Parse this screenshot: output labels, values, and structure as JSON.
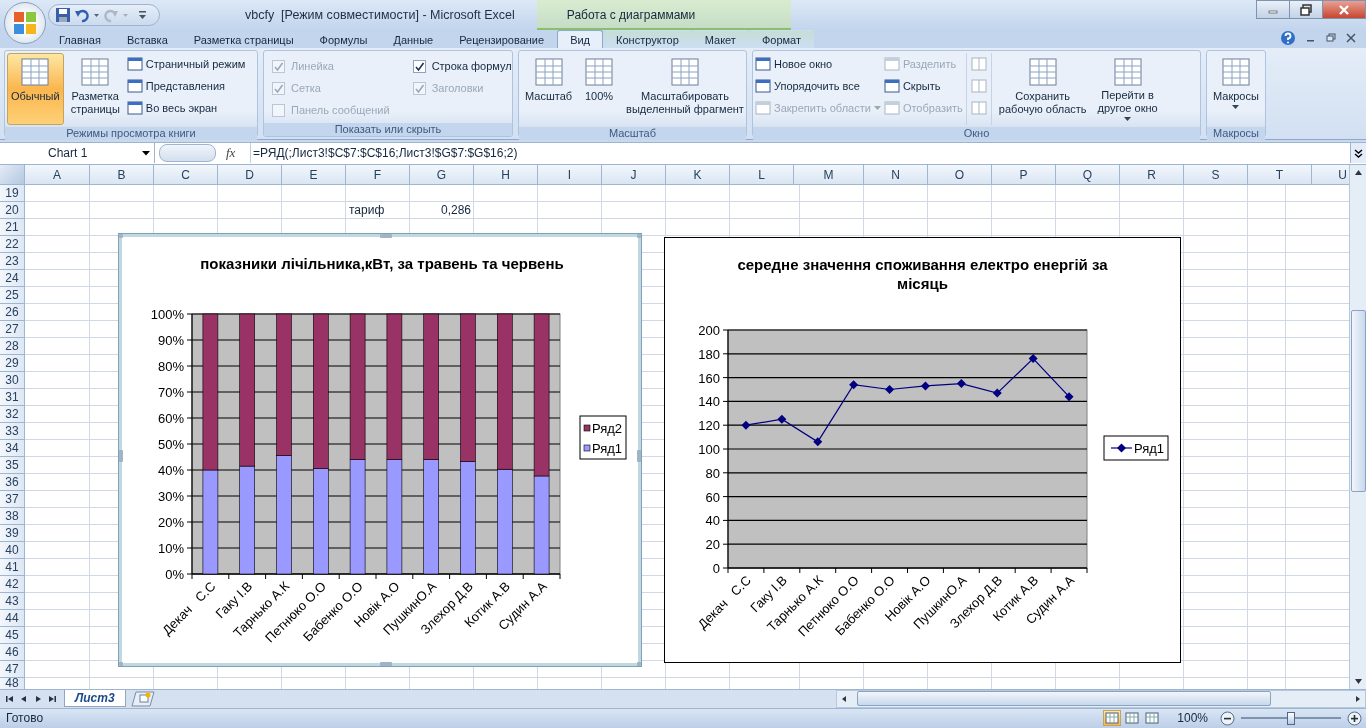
{
  "window": {
    "title": "vbcfy  [Режим совместимости] - Microsoft Excel",
    "context_group": "Работа с диаграммами"
  },
  "tabs": [
    {
      "label": "Главная",
      "selected": false,
      "kind": "main"
    },
    {
      "label": "Вставка",
      "selected": false,
      "kind": "main"
    },
    {
      "label": "Разметка страницы",
      "selected": false,
      "kind": "main"
    },
    {
      "label": "Формулы",
      "selected": false,
      "kind": "main"
    },
    {
      "label": "Данные",
      "selected": false,
      "kind": "main"
    },
    {
      "label": "Рецензирование",
      "selected": false,
      "kind": "main"
    },
    {
      "label": "Вид",
      "selected": true,
      "kind": "main"
    },
    {
      "label": "Конструктор",
      "selected": false,
      "kind": "context"
    },
    {
      "label": "Макет",
      "selected": false,
      "kind": "context"
    },
    {
      "label": "Формат",
      "selected": false,
      "kind": "context"
    }
  ],
  "ribbon_groups": [
    {
      "label": "Режимы просмотра книги",
      "columns": [
        [
          {
            "kind": "large",
            "label": "Обычный",
            "selected": true
          }
        ],
        [
          {
            "kind": "large",
            "label": "Разметка\nстраницы",
            "selected": false
          }
        ],
        [
          {
            "kind": "small",
            "label": "Страничный режим",
            "disabled": false
          },
          {
            "kind": "small",
            "label": "Представления",
            "disabled": false
          },
          {
            "kind": "small",
            "label": "Во весь экран",
            "disabled": false
          }
        ]
      ]
    },
    {
      "label": "Показать или скрыть",
      "columns": [
        [
          {
            "kind": "checkbox",
            "label": "Линейка",
            "checked": true,
            "disabled": true
          },
          {
            "kind": "checkbox",
            "label": "Сетка",
            "checked": true,
            "disabled": true
          },
          {
            "kind": "checkbox",
            "label": "Панель сообщений",
            "checked": false,
            "disabled": true
          }
        ],
        [
          {
            "kind": "checkbox",
            "label": "Строка формул",
            "checked": true,
            "disabled": false
          },
          {
            "kind": "checkbox",
            "label": "Заголовки",
            "checked": true,
            "disabled": true
          }
        ]
      ]
    },
    {
      "label": "Масштаб",
      "columns": [
        [
          {
            "kind": "large",
            "label": "Масштаб"
          }
        ],
        [
          {
            "kind": "large",
            "label": "100%"
          }
        ],
        [
          {
            "kind": "large",
            "label": "Масштабировать\nвыделенный фрагмент"
          }
        ]
      ]
    },
    {
      "label": "Окно",
      "columns": [
        [
          {
            "kind": "small",
            "label": "Новое окно",
            "disabled": false
          },
          {
            "kind": "small",
            "label": "Упорядочить все",
            "disabled": false
          },
          {
            "kind": "small",
            "label": "Закрепить области",
            "disabled": true,
            "dropdown": true
          }
        ],
        [
          {
            "kind": "small",
            "label": "Разделить",
            "disabled": true
          },
          {
            "kind": "small",
            "label": "Скрыть",
            "disabled": false
          },
          {
            "kind": "small",
            "label": "Отобразить",
            "disabled": true
          }
        ],
        [
          {
            "kind": "icon",
            "disabled": true
          },
          {
            "kind": "icon",
            "disabled": true
          },
          {
            "kind": "icon",
            "disabled": true
          }
        ],
        [
          {
            "kind": "large",
            "label": "Сохранить\nрабочую область"
          }
        ],
        [
          {
            "kind": "large",
            "label": "Перейти в\nдругое окно",
            "dropdown": true
          }
        ]
      ]
    },
    {
      "label": "Макросы",
      "columns": [
        [
          {
            "kind": "large",
            "label": "Макросы",
            "dropdown": true
          }
        ]
      ]
    }
  ],
  "formula_bar": {
    "name_box": "Chart 1",
    "fx": "fx",
    "formula": "=РЯД(;Лист3!$C$7:$C$16;Лист3!$G$7:$G$16;2)"
  },
  "sheet": {
    "columns": [
      "A",
      "B",
      "C",
      "D",
      "E",
      "F",
      "G",
      "H",
      "I",
      "J",
      "K",
      "L",
      "M",
      "N",
      "O",
      "P",
      "Q",
      "R",
      "S",
      "T",
      "U"
    ],
    "rows": [
      {
        "number": "19"
      },
      {
        "number": "20",
        "cells": [
          null,
          null,
          null,
          null,
          null,
          {
            "value": "тариф",
            "kind": "text"
          },
          {
            "value": "0,286",
            "kind": "number"
          }
        ]
      },
      {
        "number": "21"
      },
      {
        "number": "22"
      },
      {
        "number": "23"
      },
      {
        "number": "24"
      },
      {
        "number": "25"
      },
      {
        "number": "26"
      },
      {
        "number": "27"
      },
      {
        "number": "28"
      },
      {
        "number": "29"
      },
      {
        "number": "30"
      },
      {
        "number": "31"
      },
      {
        "number": "32"
      },
      {
        "number": "33"
      },
      {
        "number": "34"
      },
      {
        "number": "35"
      },
      {
        "number": "36"
      },
      {
        "number": "37"
      },
      {
        "number": "38"
      },
      {
        "number": "39"
      },
      {
        "number": "40"
      },
      {
        "number": "41"
      },
      {
        "number": "42"
      },
      {
        "number": "43"
      },
      {
        "number": "44"
      },
      {
        "number": "45"
      },
      {
        "number": "46"
      },
      {
        "number": "47"
      },
      {
        "number": "48"
      }
    ]
  },
  "charts": [
    {
      "selected": true,
      "chart_data": {
        "type": "bar",
        "stacked": true,
        "grid": true,
        "legend": true,
        "title": "показники лічільника,кВт, за травень та червень",
        "categories": [
          "Декач   С.С",
          "Гаку І.В",
          "Тарнько А.К",
          "Петнюко О.О",
          "Бабенко О.О",
          "Новік А.О",
          "ПушкинО.А",
          "Злехор Д.В",
          "Котик А.В",
          "Судин А.А"
        ],
        "series": [
          {
            "name": "Ряд1",
            "color": "#9999ff",
            "values": [
              40,
              41.5,
              45.5,
              40.5,
              44,
              44,
              44,
              43.3,
              40.3,
              37.7
            ]
          },
          {
            "name": "Ряд2",
            "color": "#993366",
            "values": [
              60,
              58.5,
              54.5,
              59.5,
              56,
              56,
              56,
              56.7,
              59.7,
              62.3
            ]
          }
        ],
        "ylim": [
          0,
          100
        ],
        "yticks": [
          {
            "value": 0,
            "label": "0%"
          },
          {
            "value": 10,
            "label": "10%"
          },
          {
            "value": 20,
            "label": "20%"
          },
          {
            "value": 30,
            "label": "30%"
          },
          {
            "value": 40,
            "label": "40%"
          },
          {
            "value": 50,
            "label": "50%"
          },
          {
            "value": 60,
            "label": "60%"
          },
          {
            "value": 70,
            "label": "70%"
          },
          {
            "value": 80,
            "label": "80%"
          },
          {
            "value": 90,
            "label": "90%"
          },
          {
            "value": 100,
            "label": "100%"
          }
        ]
      }
    },
    {
      "selected": false,
      "chart_data": {
        "type": "line",
        "grid": true,
        "legend": true,
        "title": "середне значення споживання електро енергій за місяць",
        "categories": [
          "Декач   С.С",
          "Гаку І.В",
          "Тарнько А.К",
          "Петнюко О.О",
          "Бабенко О.О",
          "Новік А.О",
          "ПушкинО.А",
          "Злехор Д.В",
          "Котик А.В",
          "Судин А.А"
        ],
        "series": [
          {
            "name": "Ряд1",
            "color": "#000080",
            "marker": "diamond",
            "values": [
              120,
              125,
              106,
              154,
              150,
              153,
              155,
              147,
              176,
              144
            ]
          }
        ],
        "ylim": [
          0,
          200
        ],
        "yticks": [
          0,
          20,
          40,
          60,
          80,
          100,
          120,
          140,
          160,
          180,
          200
        ]
      }
    }
  ],
  "sheet_tabs": [
    {
      "label": "Лист3",
      "selected": true
    }
  ],
  "status_bar": {
    "text": "Готово",
    "view_buttons": [
      {
        "selected": true
      },
      {
        "selected": false
      },
      {
        "selected": false
      }
    ],
    "zoom": "100%",
    "zoom_slider": {
      "level": 0.5
    }
  }
}
